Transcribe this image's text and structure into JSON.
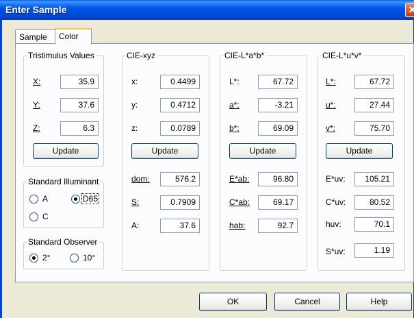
{
  "window": {
    "title": "Enter Sample",
    "close_glyph": "✕"
  },
  "tabs": [
    {
      "label": "Sample"
    },
    {
      "label": "Color"
    }
  ],
  "tristimulus": {
    "title": "Tristimulus Values",
    "x_label": "X:",
    "x_value": "35.9",
    "y_label": "Y:",
    "y_value": "37.6",
    "z_label": "Z:",
    "z_value": "6.3",
    "update": "Update"
  },
  "illuminant": {
    "title": "Standard Illuminant",
    "options": [
      "A",
      "D65",
      "C"
    ],
    "selected": "D65"
  },
  "observer": {
    "title": "Standard Observer",
    "options": [
      "2°",
      "10°"
    ],
    "selected": "2°"
  },
  "xyz": {
    "title": "CIE-xyz",
    "x_label": "x:",
    "x_value": "0.4499",
    "y_label": "y:",
    "y_value": "0.4712",
    "z_label": "z:",
    "z_value": "0.0789",
    "update": "Update",
    "dom_label": "dom:",
    "dom_value": "576.2",
    "s_label": "S:",
    "s_value": "0.7909",
    "a_label": "A:",
    "a_value": "37.6"
  },
  "lab": {
    "title": "CIE-L*a*b*",
    "l_label": "L*:",
    "l_value": "67.72",
    "a_label": "a*:",
    "a_value": "-3.21",
    "b_label": "b*:",
    "b_value": "69.09",
    "update": "Update",
    "e_label": "E*ab:",
    "e_value": "96.80",
    "c_label": "C*ab:",
    "c_value": "69.17",
    "h_label": "hab:",
    "h_value": "92.7"
  },
  "luv": {
    "title": "CIE-L*u*v*",
    "l_label": "L*:",
    "l_value": "67.72",
    "u_label": "u*:",
    "u_value": "27.44",
    "v_label": "v*:",
    "v_value": "75.70",
    "update": "Update",
    "e_label": "E*uv:",
    "e_value": "105.21",
    "c_label": "C*uv:",
    "c_value": "80.52",
    "h_label": "huv:",
    "h_value": "70.1",
    "s_label": "S*uv:",
    "s_value": "1.19"
  },
  "footer": {
    "ok": "OK",
    "cancel": "Cancel",
    "help": "Help"
  }
}
